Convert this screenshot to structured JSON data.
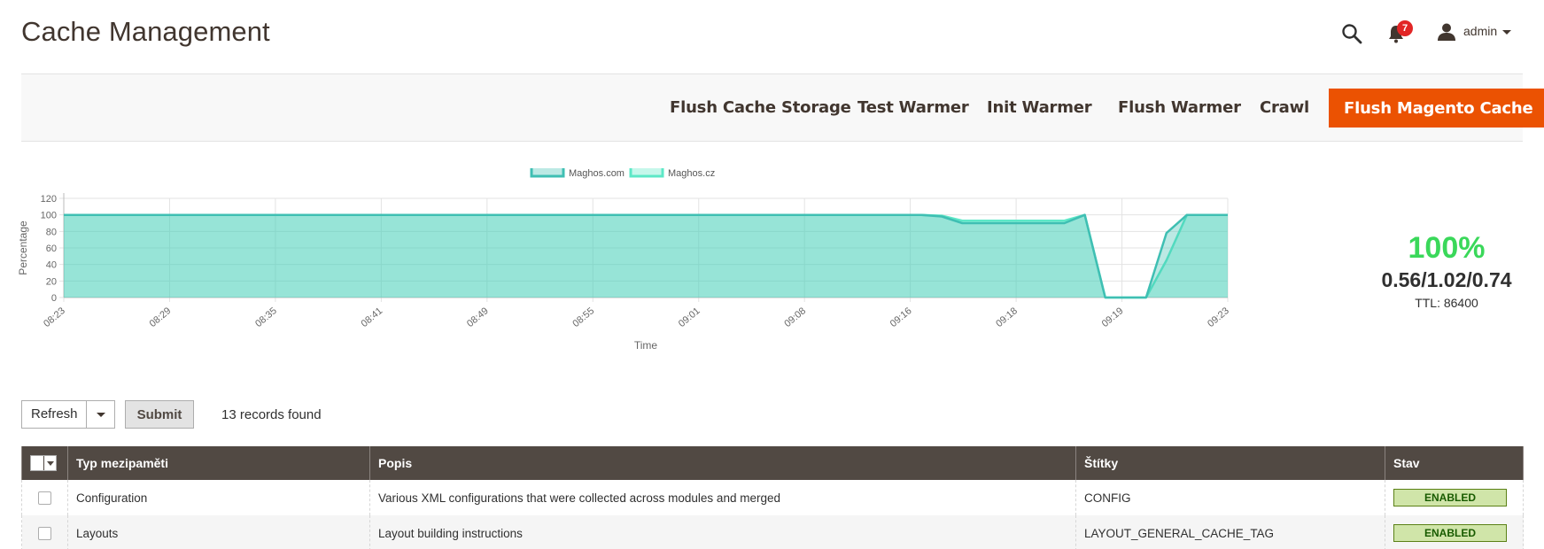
{
  "page": {
    "title": "Cache Management"
  },
  "header": {
    "notifications_count": "7",
    "user_name": "admin",
    "icons": [
      "search-icon",
      "bell-icon",
      "user-icon",
      "caret-down-icon"
    ]
  },
  "actions": {
    "flush_cache_storage": "Flush Cache Storage",
    "test_warmer": "Test Warmer",
    "init_warmer": "Init Warmer",
    "flush_warmer": "Flush Warmer",
    "crawl": "Crawl",
    "flush_magento_cache": "Flush Magento Cache"
  },
  "colors": {
    "accent": "#eb5202",
    "header_bg": "#514943",
    "series1": "#3fbfb3",
    "series2": "#5de8c7",
    "percent_green": "#3ad85a"
  },
  "chart_data": {
    "type": "area",
    "xlabel": "Time",
    "ylabel": "Percentage",
    "ylim": [
      0,
      120
    ],
    "yticks": [
      0,
      20,
      40,
      60,
      80,
      100,
      120
    ],
    "x_tick_labels": [
      "08:23",
      "08:29",
      "08:35",
      "08:41",
      "08:49",
      "08:55",
      "09:01",
      "09:08",
      "09:16",
      "09:18",
      "09:19",
      "09:23"
    ],
    "legend_position": "top-center",
    "grid": true,
    "series": [
      {
        "name": "Maghos.com",
        "values": [
          100,
          100,
          100,
          100,
          100,
          100,
          100,
          100,
          100,
          100,
          100,
          100,
          100,
          100,
          100,
          100,
          100,
          100,
          100,
          100,
          100,
          100,
          100,
          100,
          100,
          100,
          100,
          100,
          100,
          100,
          100,
          100,
          100,
          100,
          100,
          100,
          100,
          100,
          100,
          100,
          100,
          100,
          100,
          98,
          90,
          90,
          90,
          90,
          90,
          90,
          100,
          0,
          0,
          0,
          78,
          100,
          100,
          100
        ]
      },
      {
        "name": "Maghos.cz",
        "values": [
          100,
          100,
          100,
          100,
          100,
          100,
          100,
          100,
          100,
          100,
          100,
          100,
          100,
          100,
          100,
          100,
          100,
          100,
          100,
          100,
          100,
          100,
          100,
          100,
          100,
          100,
          100,
          100,
          100,
          100,
          100,
          100,
          100,
          100,
          100,
          100,
          100,
          100,
          100,
          100,
          100,
          100,
          100,
          99,
          93,
          93,
          93,
          93,
          93,
          93,
          100,
          0,
          0,
          0,
          45,
          100,
          100,
          100
        ]
      }
    ]
  },
  "stats": {
    "percent": "100%",
    "load": "0.56/1.02/0.74",
    "ttl": "TTL: 86400"
  },
  "toolbar": {
    "mass_action": "Refresh",
    "submit_label": "Submit",
    "records_found": "13 records found"
  },
  "grid": {
    "columns": [
      "Typ mezipaměti",
      "Popis",
      "Štítky",
      "Stav"
    ],
    "rows": [
      {
        "type": "Configuration",
        "description": "Various XML configurations that were collected across modules and merged",
        "tags": "CONFIG",
        "status": "ENABLED"
      },
      {
        "type": "Layouts",
        "description": "Layout building instructions",
        "tags": "LAYOUT_GENERAL_CACHE_TAG",
        "status": "ENABLED"
      }
    ]
  }
}
